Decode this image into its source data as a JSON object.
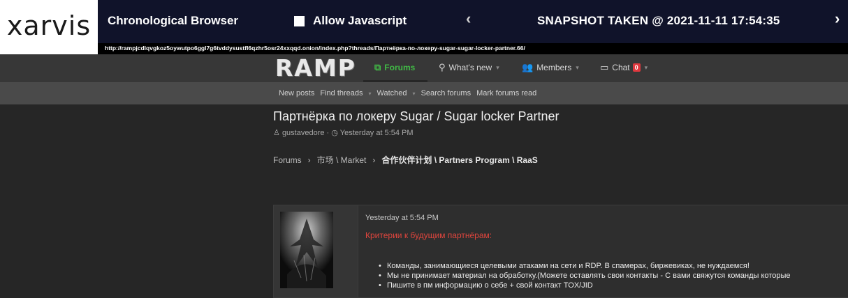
{
  "brand": {
    "logo": "xarvis"
  },
  "topbar": {
    "title": "Chronological Browser",
    "javascript_label": "Allow Javascript",
    "javascript_checked": false,
    "prev_icon": "chevron-left-icon",
    "prev_symbol": "‹",
    "snapshot": "SNAPSHOT TAKEN @ 2021-11-11 17:54:35",
    "next_icon": "chevron-right-icon",
    "next_symbol": "›",
    "url": "http://rampjcdlqvgkoz5oywutpo6ggl7g6tvddysustfl6qzhr5osr24xxqqd.onion/index.php?threads/Партнёрка-по-локеру-sugar-sugar-locker-partner.66/"
  },
  "forum": {
    "logo": "RAMP",
    "nav": [
      {
        "label": "Forums",
        "icon": "forums-icon",
        "symbol": "⧉",
        "active": true,
        "dropdown": false
      },
      {
        "label": "What's new",
        "icon": "whats-new-icon",
        "symbol": "⚲",
        "active": false,
        "dropdown": true
      },
      {
        "label": "Members",
        "icon": "members-icon",
        "symbol": "👥",
        "active": false,
        "dropdown": true
      },
      {
        "label": "Chat",
        "icon": "chat-icon",
        "symbol": "▭",
        "active": false,
        "dropdown": true,
        "badge": "0"
      }
    ],
    "subnav": [
      {
        "label": "New posts",
        "dropdown": false
      },
      {
        "label": "Find threads",
        "dropdown": true
      },
      {
        "label": "Watched",
        "dropdown": true
      },
      {
        "label": "Search forums",
        "dropdown": false
      },
      {
        "label": "Mark forums read",
        "dropdown": false
      }
    ]
  },
  "thread": {
    "title": "Партнёрка по локеру Sugar / Sugar locker Partner",
    "author": "gustavedore",
    "author_icon": "user-icon",
    "time_icon": "clock-icon",
    "posted": "Yesterday at 5:54 PM",
    "breadcrumb": [
      "Forums",
      "市场 \\ Market",
      "合作伙伴计划 \\ Partners Program \\ RaaS"
    ]
  },
  "post": {
    "date": "Yesterday at 5:54 PM",
    "heading": "Критерии к будущим партнёрам:",
    "items": [
      "Команды, занимающиеся целевыми атаками на сети и RDP. В спамерах, биржевиках, не нуждаемся!",
      "Мы не принимает материал на обработку.(Можете оставлять свои контакты - С вами свяжутся команды которые",
      "Пишите в пм информацию о себе + свой контакт TOX/JID"
    ]
  },
  "colors": {
    "topbar_bg": "#10132a",
    "active_nav": "#41b846",
    "post_heading": "#e0453d",
    "badge": "#e0383e"
  }
}
